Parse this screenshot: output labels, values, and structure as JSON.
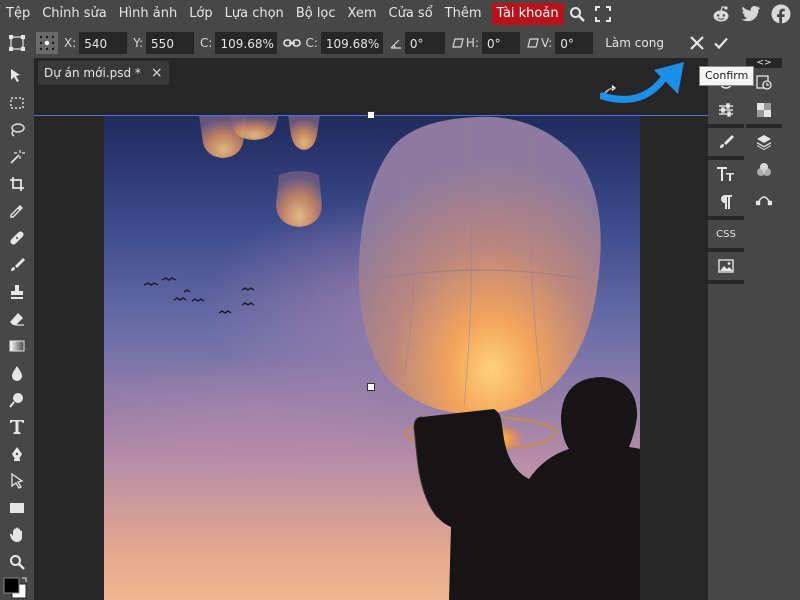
{
  "menu": {
    "items": [
      "Tệp",
      "Chỉnh sửa",
      "Hình ảnh",
      "Lớp",
      "Lựa chọn",
      "Bộ lọc",
      "Xem",
      "Cửa sổ",
      "Thêm"
    ],
    "account": "Tài khoản",
    "icons": [
      "search-icon",
      "fullscreen-icon"
    ],
    "social": [
      "reddit-icon",
      "twitter-icon",
      "facebook-icon"
    ]
  },
  "options": {
    "x_label": "X:",
    "x_value": "540 px",
    "y_label": "Y:",
    "y_value": "550 px",
    "w_label": "C:",
    "w_value": "109.68%",
    "h_label": "C:",
    "h_value": "109.68%",
    "angle_value": "0°",
    "skew_h_label": "H:",
    "skew_h_value": "0°",
    "skew_v_label": "V:",
    "skew_v_value": "0°",
    "warp_button": "Làm cong",
    "cancel_icon": "close-icon",
    "confirm_icon": "checkmark-icon"
  },
  "document": {
    "tab_title": "Dự án mới.psd *",
    "close_label": "×"
  },
  "tooltip": {
    "text": "Confirm"
  },
  "right_panel": {
    "css_label": "CSS",
    "code_label": "<>"
  },
  "colors": {
    "app_bg": "#474747",
    "workspace_bg": "#262626",
    "account_red": "#b8131c",
    "guide_blue": "#4a74e0",
    "arrow_blue": "#1e8fe6"
  }
}
